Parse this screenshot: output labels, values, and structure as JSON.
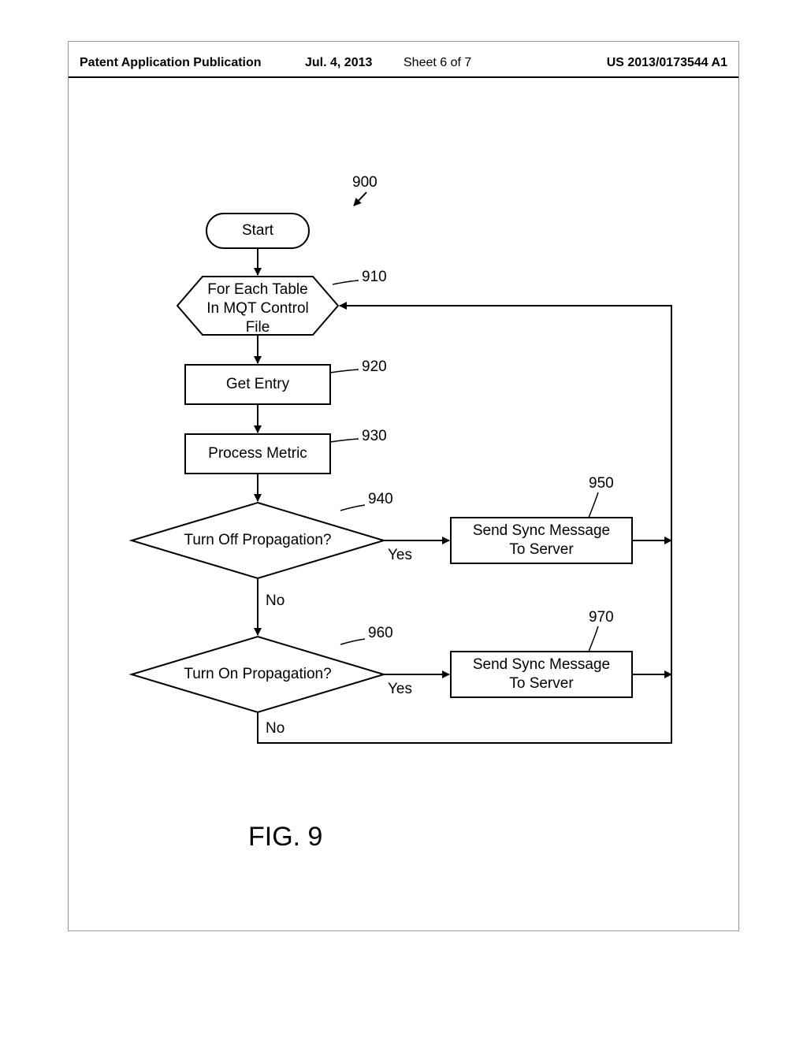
{
  "header": {
    "left": "Patent Application Publication",
    "date": "Jul. 4, 2013",
    "sheet": "Sheet 6 of 7",
    "pubno": "US 2013/0173544 A1"
  },
  "refs": {
    "fig": "900",
    "loop": "910",
    "getEntry": "920",
    "processMetric": "930",
    "offDecision": "940",
    "offAction": "950",
    "onDecision": "960",
    "onAction": "970"
  },
  "nodes": {
    "start": "Start",
    "loop": "For Each Table\nIn MQT Control\nFile",
    "getEntry": "Get Entry",
    "processMetric": "Process Metric",
    "offDecision": "Turn Off Propagation?",
    "onDecision": "Turn On Propagation?",
    "offAction": "Send Sync Message\nTo Server",
    "onAction": "Send Sync Message\nTo Server"
  },
  "edges": {
    "yes": "Yes",
    "no": "No"
  },
  "caption": "FIG. 9"
}
